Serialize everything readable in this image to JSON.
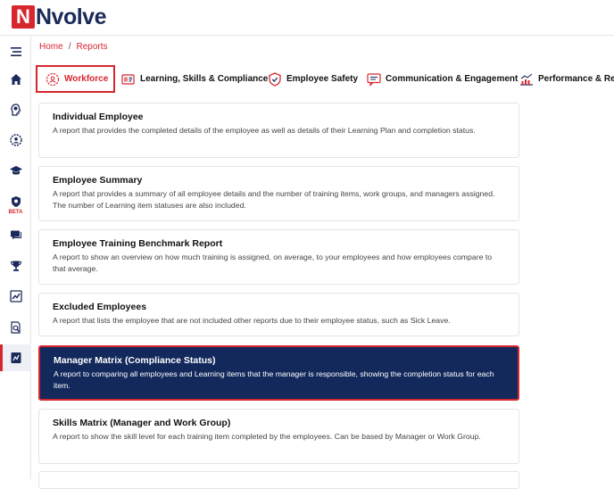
{
  "app": {
    "logo_letter": "N",
    "logo_text": "Nvolve"
  },
  "breadcrumb": {
    "home": "Home",
    "separator": "/",
    "current": "Reports"
  },
  "sidebar": {
    "items": [
      {
        "icon": "menu-icon"
      },
      {
        "icon": "home-icon"
      },
      {
        "icon": "learning-head-icon"
      },
      {
        "icon": "user-gear-icon"
      },
      {
        "icon": "graduation-cap-icon"
      },
      {
        "icon": "beta-shield-icon",
        "badge": "BETA"
      },
      {
        "icon": "chat-icon"
      },
      {
        "icon": "trophy-icon"
      },
      {
        "icon": "chart-icon"
      },
      {
        "icon": "document-search-icon"
      },
      {
        "icon": "reports-icon"
      }
    ]
  },
  "tabs": [
    {
      "label": "Workforce",
      "icon": "workforce-icon",
      "active": true
    },
    {
      "label": "Learning, Skills & Compliance",
      "icon": "learning-icon",
      "active": false
    },
    {
      "label": "Employee Safety",
      "icon": "safety-icon",
      "active": false
    },
    {
      "label": "Communication & Engagement",
      "icon": "communication-icon",
      "active": false
    },
    {
      "label": "Performance & Reco",
      "icon": "performance-icon",
      "active": false
    }
  ],
  "reports": [
    {
      "title": "Individual Employee",
      "description": "A report that provides the completed details of the employee as well as details of their Learning Plan and completion status."
    },
    {
      "title": "Employee Summary",
      "description": "A report that provides a summary of all employee details and the number of training items, work groups, and managers assigned. The number of Learning item statuses are also included."
    },
    {
      "title": "Employee Training Benchmark Report",
      "description": "A report to show an overview on how much training is assigned, on average, to your employees and how employees compare to that average."
    },
    {
      "title": "Excluded Employees",
      "description": "A report that lists the employee that are not included other reports due to their employee status, such as Sick Leave."
    },
    {
      "title": "Manager Matrix (Compliance Status)",
      "description": "A report to comparing all employees and Learning items that the manager is responsible, showing the completion status for each item."
    },
    {
      "title": "Skills Matrix (Manager and Work Group)",
      "description": "A report to show the skill level for each training item completed by the employees. Can be based by Manager or Work Group."
    }
  ],
  "colors": {
    "brand_red": "#d8262f",
    "navy": "#13295c"
  }
}
